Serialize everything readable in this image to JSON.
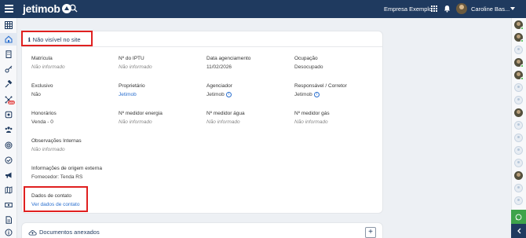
{
  "app": {
    "logo": "jetimob",
    "company": "Empresa Exemplo",
    "user_name": "Caroline Bas..."
  },
  "sidebar": {
    "items": [
      {
        "icon": "grid-icon"
      },
      {
        "icon": "home-icon"
      },
      {
        "icon": "building-icon"
      },
      {
        "icon": "key-icon"
      },
      {
        "icon": "hammer-icon"
      },
      {
        "icon": "network-icon",
        "badge": "100"
      },
      {
        "icon": "refresh-icon"
      },
      {
        "icon": "users-icon"
      },
      {
        "icon": "target-icon"
      },
      {
        "icon": "check-circle-icon"
      },
      {
        "icon": "megaphone-icon"
      },
      {
        "icon": "map-icon"
      },
      {
        "icon": "money-icon"
      },
      {
        "icon": "document-icon"
      },
      {
        "icon": "info-icon"
      }
    ]
  },
  "card": {
    "visibility_text": "Não visível no site",
    "fields": {
      "matricula": {
        "label": "Matrícula",
        "value": "Não informado"
      },
      "iptu": {
        "label": "Nº do IPTU",
        "value": "Não informado"
      },
      "data_agenciamento": {
        "label": "Data agenciamento",
        "value": "11/02/2026"
      },
      "ocupacao": {
        "label": "Ocupação",
        "value": "Desocupado"
      },
      "exclusivo": {
        "label": "Exclusivo",
        "value": "Não"
      },
      "proprietario": {
        "label": "Proprietário",
        "value": "Jetimob"
      },
      "agenciador": {
        "label": "Agenciador",
        "value": "Jetimob"
      },
      "responsavel": {
        "label": "Responsável / Corretor",
        "value": "Jetimob"
      },
      "honorarios": {
        "label": "Honorários",
        "value": "Venda - 0"
      },
      "medidor_energia": {
        "label": "Nº medidor energia",
        "value": "Não informado"
      },
      "medidor_agua": {
        "label": "Nº medidor água",
        "value": "Não informado"
      },
      "medidor_gas": {
        "label": "Nº medidor gás",
        "value": "Não informado"
      },
      "observacoes": {
        "label": "Observações Internas",
        "value": "Não informado"
      },
      "origem_externa": {
        "label": "Informações de origem externa",
        "value": "Fornecedor: Tenda RS"
      },
      "dados_contato": {
        "label": "Dados de contato",
        "value": "Ver dados de contato"
      }
    }
  },
  "docs": {
    "title": "Documentos anexados",
    "add_label": "+"
  },
  "colors": {
    "topbar": "#1f3a5f",
    "link": "#2a6fcf",
    "highlight": "#e02020",
    "online": "#34b233"
  }
}
